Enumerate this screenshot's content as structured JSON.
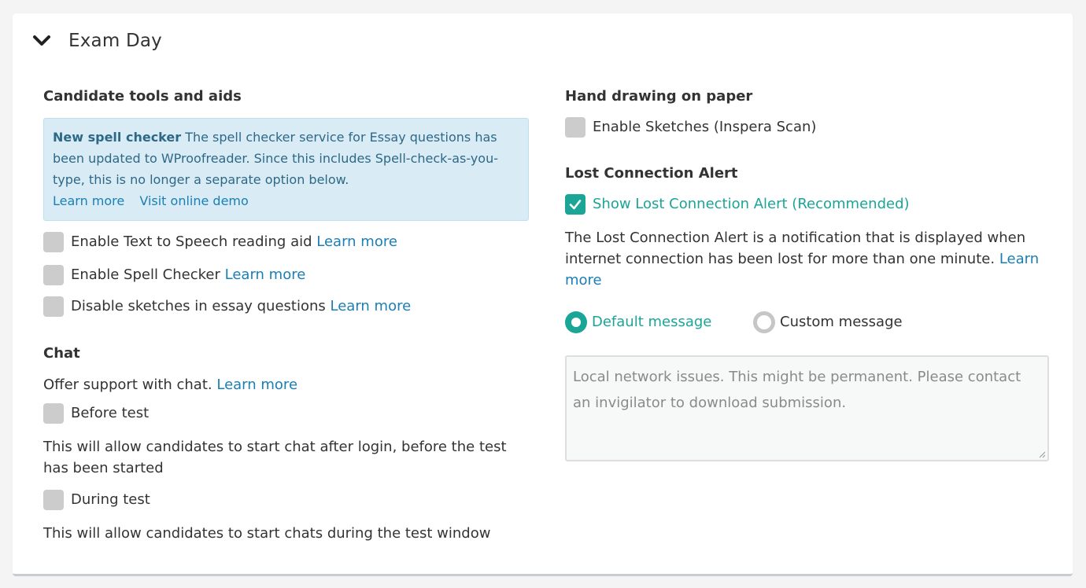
{
  "panel": {
    "title": "Exam Day",
    "icon": "chevron-down-icon"
  },
  "left": {
    "tools_heading": "Candidate tools and aids",
    "info": {
      "headline": "New spell checker",
      "body": " The spell checker service for Essay questions has been updated to WProofreader. Since this includes Spell-check-as-you-type, this is no longer a separate option below.",
      "link1": "Learn more",
      "link2": "Visit online demo"
    },
    "options": [
      {
        "label": "Enable Text to Speech reading aid",
        "link": "Learn more",
        "checked": false
      },
      {
        "label": "Enable Spell Checker",
        "link": "Learn more",
        "checked": false
      },
      {
        "label": "Disable sketches in essay questions",
        "link": "Learn more",
        "checked": false
      }
    ],
    "chat": {
      "heading": "Chat",
      "intro": "Offer support with chat.",
      "intro_link": "Learn more",
      "before_label": "Before test",
      "before_checked": false,
      "before_desc": "This will allow candidates to start chat after login, before the test has been started",
      "during_label": "During test",
      "during_checked": false,
      "during_desc": "This will allow candidates to start chats during the test window"
    }
  },
  "right": {
    "hand_heading": "Hand drawing on paper",
    "sketches_label": "Enable Sketches (Inspera Scan)",
    "sketches_checked": false,
    "alert_heading": "Lost Connection Alert",
    "alert_label": "Show Lost Connection Alert (Recommended)",
    "alert_checked": true,
    "alert_desc": "The Lost Connection Alert is a notification that is displayed when internet connection has been lost for more than one minute.",
    "alert_link": "Learn more",
    "radio_default": "Default message",
    "radio_custom": "Custom message",
    "selected_radio": "default",
    "message_placeholder": "Local network issues. This might be permanent. Please contact an invigilator to download submission."
  },
  "colors": {
    "accent": "#1ba596",
    "link": "#1a7fb5",
    "info_bg": "#d9ecf5"
  }
}
